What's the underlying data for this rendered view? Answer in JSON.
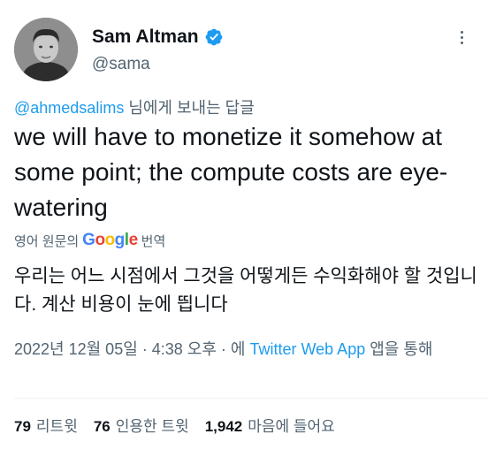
{
  "author": {
    "name": "Sam Altman",
    "handle": "@sama"
  },
  "reply": {
    "mention": "@ahmedsalims",
    "suffix": " 님에게 보내는 답글"
  },
  "tweet_text": "we will have to monetize it somehow at some point; the compute costs are eye-watering",
  "translation": {
    "prefix": "영어 원문의",
    "suffix": "번역",
    "google": {
      "g1": "G",
      "o1": "o",
      "o2": "o",
      "g2": "g",
      "l": "l",
      "e": "e"
    },
    "text": "우리는 어느 시점에서 그것을 어떻게든 수익화해야 할 것입니다. 계산 비용이 눈에 띕니다"
  },
  "meta": {
    "timestamp": "2022년 12월 05일 · 4:38 오후 · 에 ",
    "source": "Twitter Web App",
    "suffix": " 앱을 통해"
  },
  "stats": {
    "retweets_count": "79",
    "retweets_label": "리트윗",
    "quotes_count": "76",
    "quotes_label": "인용한 트윗",
    "likes_count": "1,942",
    "likes_label": "마음에 들어요"
  },
  "colors": {
    "accent": "#1d9bf0",
    "secondary_text": "#536471",
    "primary_text": "#0f1419"
  },
  "icons": {
    "verified": "verified-badge-icon",
    "more": "more-options-icon"
  }
}
